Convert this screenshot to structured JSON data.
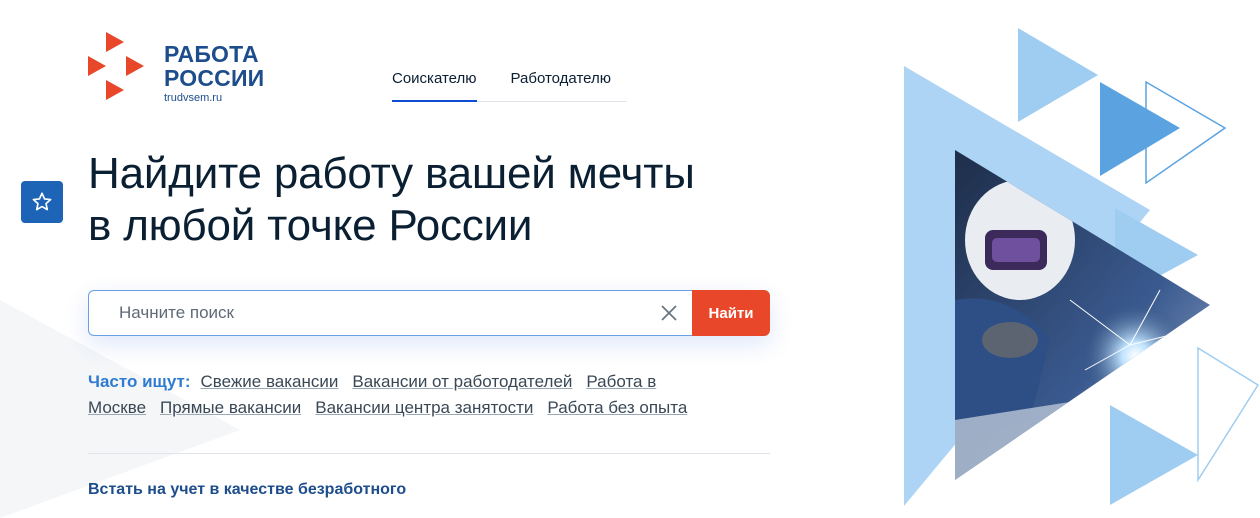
{
  "logo": {
    "line1": "РАБОТА",
    "line2": "РОССИИ",
    "domain": "trudvsem.ru",
    "mark_color": "#e8472a"
  },
  "tabs": [
    {
      "label": "Соискателю",
      "active": true
    },
    {
      "label": "Работодателю",
      "active": false
    }
  ],
  "favorite": {
    "icon": "star-icon"
  },
  "headline": {
    "line1": "Найдите работу вашей мечты",
    "line2": "в любой точке России"
  },
  "search": {
    "placeholder": "Начните поиск",
    "value": "",
    "clear_icon": "close-icon",
    "button_label": "Найти"
  },
  "popular": {
    "label": "Часто ищут:",
    "links": [
      "Свежие вакансии",
      "Вакансии от работодателей",
      "Работа в Москве",
      "Прямые вакансии",
      "Вакансии центра занятости",
      "Работа без опыта"
    ]
  },
  "bottom_link": "Встать на учет в качестве безработного",
  "colors": {
    "brand_blue": "#1d4d8c",
    "accent_red": "#e8472a",
    "light_blue": "#6fb1ea",
    "tab_underline": "#0d4cd3"
  }
}
